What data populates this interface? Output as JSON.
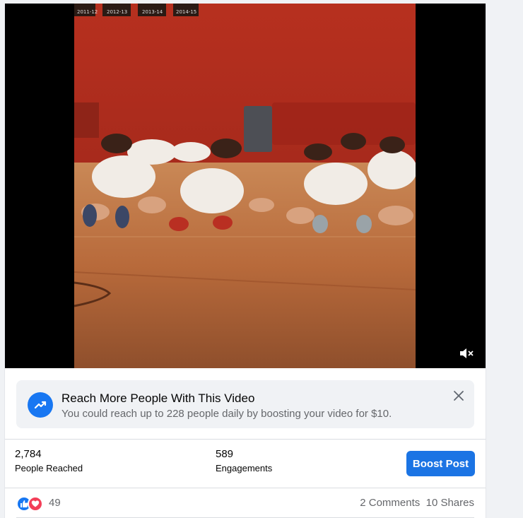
{
  "promo": {
    "title": "Reach More People With This Video",
    "description": "You could reach up to 228 people daily by boosting your video for $10.",
    "icon": "trending-up-icon"
  },
  "stats": {
    "people_reached_value": "2,784",
    "people_reached_label": "People Reached",
    "engagements_value": "589",
    "engagements_label": "Engagements"
  },
  "boost_button_label": "Boost Post",
  "reactions": {
    "icons": [
      "like-icon",
      "love-icon"
    ],
    "count": "49"
  },
  "comments_label": "2 Comments",
  "shares_label": "10 Shares",
  "video": {
    "banner_labels": [
      "2011-12",
      "2012-13",
      "2013-14",
      "2014-15"
    ],
    "muted": true
  },
  "colors": {
    "accent": "#1b74e4",
    "love": "#f33e58"
  }
}
